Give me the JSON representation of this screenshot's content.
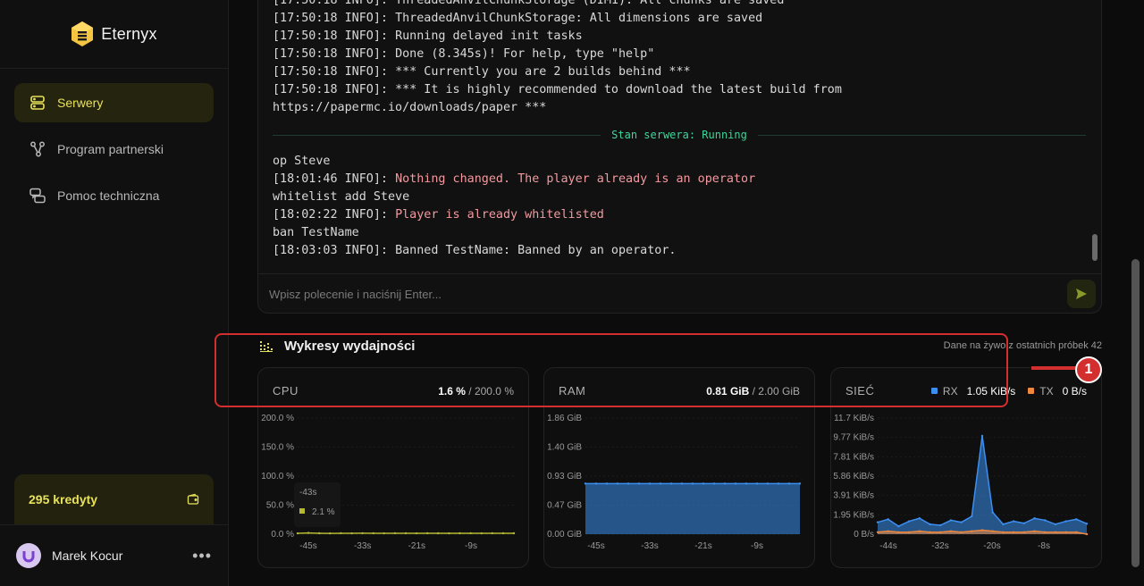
{
  "app": {
    "name": "Eternyx"
  },
  "sidebar": {
    "items": [
      {
        "label": "Serwery",
        "icon": "server-icon",
        "active": true
      },
      {
        "label": "Program partnerski",
        "icon": "share-icon",
        "active": false
      },
      {
        "label": "Pomoc techniczna",
        "icon": "chat-icon",
        "active": false
      }
    ],
    "credits": {
      "label": "295 kredyty",
      "icon": "wallet-icon"
    },
    "user": {
      "name": "Marek Kocur",
      "menu": "•••"
    }
  },
  "console": {
    "lines_before": [
      {
        "prefix": "[17:50:18 INFO]: ",
        "text": "ThreadedAnvilChunkStorage (DIM1): All chunks are saved",
        "highlight": false
      },
      {
        "prefix": "[17:50:18 INFO]: ",
        "text": "ThreadedAnvilChunkStorage: All dimensions are saved",
        "highlight": false
      },
      {
        "prefix": "[17:50:18 INFO]: ",
        "text": "Running delayed init tasks",
        "highlight": false
      },
      {
        "prefix": "[17:50:18 INFO]: ",
        "text": "Done (8.345s)! For help, type \"help\"",
        "highlight": false
      },
      {
        "prefix": "[17:50:18 INFO]: ",
        "text": "*** Currently you are 2 builds behind ***",
        "highlight": false
      },
      {
        "prefix": "[17:50:18 INFO]: ",
        "text": "*** It is highly recommended to download the latest build from",
        "highlight": false
      },
      {
        "prefix": "",
        "text": "https://papermc.io/downloads/paper ***",
        "highlight": false
      }
    ],
    "status": "Stan serwera: Running",
    "lines_after": [
      {
        "prefix": "",
        "text": "op Steve",
        "highlight": false
      },
      {
        "prefix": "[18:01:46 INFO]: ",
        "text": "Nothing changed. The player already is an operator",
        "highlight": true
      },
      {
        "prefix": "",
        "text": "whitelist add Steve",
        "highlight": false
      },
      {
        "prefix": "[18:02:22 INFO]: ",
        "text": "Player is already whitelisted",
        "highlight": true
      },
      {
        "prefix": "",
        "text": "ban TestName",
        "highlight": false
      },
      {
        "prefix": "[18:03:03 INFO]: ",
        "text": "Banned TestName: Banned by an operator.",
        "highlight": false
      }
    ],
    "input_placeholder": "Wpisz polecenie i naciśnij Enter..."
  },
  "performance": {
    "title": "Wykresy wydajności",
    "subtitle": "Dane na żywo z ostatnich próbek 42",
    "cpu": {
      "label": "CPU",
      "value": "1.6 %",
      "sep": " / ",
      "max": "200.0 %",
      "tooltip_time": "-43s",
      "tooltip_value": "2.1 %"
    },
    "ram": {
      "label": "RAM",
      "value": "0.81 GiB",
      "sep": " / ",
      "max": "2.00 GiB"
    },
    "net": {
      "label": "SIEĆ",
      "rx_label": "RX",
      "rx_value": "1.05 KiB/s",
      "tx_label": "TX",
      "tx_value": "0 B/s"
    }
  },
  "annotation": {
    "badge": "1"
  },
  "colors": {
    "accent": "#e8e25a",
    "rx": "#3b8ff0",
    "tx": "#f0883b",
    "status": "#3fd69a",
    "annotation": "#d32f2f"
  },
  "chart_data": [
    {
      "type": "line",
      "title": "CPU",
      "x_ticks": [
        "-45s",
        "-33s",
        "-21s",
        "-9s"
      ],
      "y_ticks": [
        "200.0 %",
        "150.0 %",
        "100.0 %",
        "50.0 %",
        "0.0 %"
      ],
      "ylim": [
        0,
        200
      ],
      "series": [
        {
          "values": [
            1.5,
            2.1,
            1.6,
            1.4,
            1.6,
            1.5,
            1.7,
            1.6,
            1.5,
            1.6,
            1.6,
            1.5,
            1.6,
            1.6,
            1.5,
            1.6,
            1.6,
            1.5,
            1.6,
            1.6,
            1.6
          ]
        }
      ]
    },
    {
      "type": "area",
      "title": "RAM",
      "x_ticks": [
        "-45s",
        "-33s",
        "-21s",
        "-9s"
      ],
      "y_ticks": [
        "1.86 GiB",
        "1.40 GiB",
        "0.93 GiB",
        "0.47 GiB",
        "0.00 GiB"
      ],
      "ylim": [
        0,
        1.86
      ],
      "series": [
        {
          "values": [
            0.81,
            0.81,
            0.81,
            0.81,
            0.81,
            0.81,
            0.81,
            0.81,
            0.81,
            0.81,
            0.81,
            0.81,
            0.81,
            0.81,
            0.81,
            0.81,
            0.81,
            0.81,
            0.81,
            0.81,
            0.81
          ]
        }
      ]
    },
    {
      "type": "area",
      "title": "SIEĆ",
      "x_ticks": [
        "-44s",
        "-32s",
        "-20s",
        "-8s"
      ],
      "y_ticks": [
        "11.7 KiB/s",
        "9.77 KiB/s",
        "7.81 KiB/s",
        "5.86 KiB/s",
        "3.91 KiB/s",
        "1.95 KiB/s",
        "0 B/s"
      ],
      "ylim": [
        0,
        11.7
      ],
      "series": [
        {
          "name": "RX",
          "values": [
            1.2,
            1.5,
            0.8,
            1.3,
            1.6,
            1.0,
            0.9,
            1.4,
            1.2,
            1.8,
            9.9,
            2.2,
            1.0,
            1.3,
            1.1,
            1.6,
            1.4,
            1.0,
            1.3,
            1.5,
            1.05
          ]
        },
        {
          "name": "TX",
          "values": [
            0.2,
            0.3,
            0.2,
            0.2,
            0.3,
            0.2,
            0.2,
            0.3,
            0.2,
            0.3,
            0.4,
            0.3,
            0.2,
            0.2,
            0.2,
            0.3,
            0.2,
            0.2,
            0.2,
            0.2,
            0
          ]
        }
      ]
    }
  ]
}
